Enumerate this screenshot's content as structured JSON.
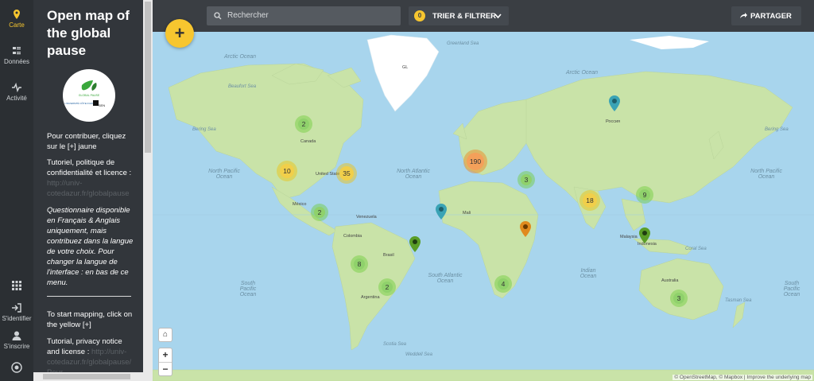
{
  "nav": {
    "items": [
      {
        "label": "Carte",
        "icon": "map-pin-icon"
      },
      {
        "label": "Données",
        "icon": "list-icon"
      },
      {
        "label": "Activité",
        "icon": "activity-icon"
      }
    ],
    "bottom": [
      {
        "label": "",
        "icon": "apps-grid-icon"
      },
      {
        "label": "S'identifier",
        "icon": "login-icon"
      },
      {
        "label": "S'inscrire",
        "icon": "user-icon"
      },
      {
        "label": "",
        "icon": "brand-icon"
      }
    ]
  },
  "panel": {
    "title": "Open map of the global pause",
    "logo_text": [
      "GLOBAL PAUSE",
      "UNIVERSITÉ CÔTE D'AZUR",
      "SEN"
    ],
    "intro_fr": "Pour contribuer, cliquez sur le [+] jaune",
    "tutorial_fr": "Tutoriel, politique de confidentialité et licence :",
    "link_fr": "http://univ-cotedazur.fr/globalpause",
    "questionnaire_fr": "Questionnaire disponible en Français & Anglais uniquement, mais contribuez dans la langue de votre choix. Pour changer la langue de l'interface : en bas de ce menu.",
    "intro_en": "To start mapping, click on the yellow [+]",
    "tutorial_en": "Tutorial, privacy notice and license :",
    "link_en": "http://univ-cotedazur.fr/globalpause/ Pour"
  },
  "toolbar": {
    "search_placeholder": "Rechercher",
    "filter_count": "0",
    "filter_label": "TRIER & FILTRER",
    "share_label": "PARTAGER",
    "add_label": "+"
  },
  "map_controls": {
    "home": "⌂",
    "zoom_in": "+",
    "zoom_out": "−"
  },
  "clusters": [
    "2",
    "10",
    "35",
    "190",
    "3",
    "18",
    "9",
    "2",
    "8",
    "2",
    "4",
    "3"
  ],
  "map_labels": {
    "arctic_ocean_left": "Arctic Ocean",
    "arctic_ocean_right": "Arctic Ocean",
    "greenland_sea": "Greenland Sea",
    "greenland": "GL",
    "north_pacific_left": "North Pacific Ocean",
    "north_pacific_right": "North Pacific Ocean",
    "north_atlantic": "North Atlantic Ocean",
    "south_pacific_left": "South Pacific Ocean",
    "south_pacific_right": "South Pacific Ocean",
    "south_atlantic": "South Atlantic Ocean",
    "indian_ocean": "Indian Ocean",
    "canada": "Canada",
    "united_states": "United States",
    "mexico": "México",
    "colombia": "Colombia",
    "venezuela": "Venezuela",
    "brasil": "Brasil",
    "argentina": "Argentina",
    "russia": "Россия",
    "australia": "Australia",
    "indonesia": "Indonesia",
    "malaysia": "Malaysia",
    "mali": "Mali",
    "beaufort_sea": "Beaufort Sea",
    "bering_sea": "Bering Sea",
    "weddell_sea": "Weddell Sea",
    "scotia_sea": "Scotia Sea",
    "tasman_sea": "Tasman Sea",
    "coral_sea": "Coral Sea"
  },
  "attribution": "© OpenStreetMap, © Mapbox | Improve the underlying map",
  "colors": {
    "accent": "#f7c62f",
    "sidebar": "#32363b",
    "rail": "#2b2f33",
    "ocean": "#a8d5ed",
    "land": "#c9e3a8",
    "ice": "#ffffff",
    "cluster_green": "#8fd16b",
    "cluster_yellow": "#f1cf4a",
    "cluster_orange": "#f4a05a"
  }
}
